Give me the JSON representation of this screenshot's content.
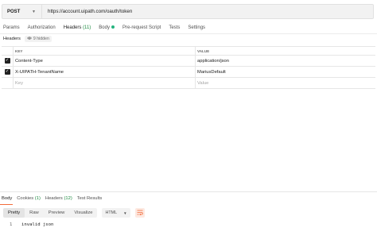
{
  "request": {
    "method": "POST",
    "url": "https://account.uipath.com/oauth/token"
  },
  "request_tabs": [
    {
      "label": "Params"
    },
    {
      "label": "Authorization"
    },
    {
      "label": "Headers",
      "count": "(11)"
    },
    {
      "label": "Body"
    },
    {
      "label": "Pre-request Script"
    },
    {
      "label": "Tests"
    },
    {
      "label": "Settings"
    }
  ],
  "headers_section": {
    "label": "Headers",
    "hidden_label": "9 hidden"
  },
  "headers_table": {
    "columns": {
      "key": "KEY",
      "value": "VALUE"
    },
    "rows": [
      {
        "key": "Content-Type",
        "value": "application/json",
        "checked": true
      },
      {
        "key": "X-UIPATH-TenantName",
        "value": "MariusDefault",
        "checked": true
      }
    ],
    "placeholder": {
      "key": "Key",
      "value": "Value"
    }
  },
  "response_tabs": [
    {
      "label": "Body"
    },
    {
      "label": "Cookies",
      "count": "(1)"
    },
    {
      "label": "Headers",
      "count": "(12)"
    },
    {
      "label": "Test Results"
    }
  ],
  "response_view": {
    "modes": [
      "Pretty",
      "Raw",
      "Preview",
      "Visualize"
    ],
    "format": "HTML"
  },
  "response_body": {
    "line_number": "1",
    "text": "invalid json"
  },
  "colors": {
    "accent": "#f26b3a",
    "count_green": "#1b8a3f",
    "body_dot": "#26b47f"
  },
  "icons": {
    "method_chevron": "chevron-down-icon",
    "hidden": "eye-icon",
    "wrap": "wrap-lines-icon",
    "checkbox": "checkmark-icon"
  }
}
